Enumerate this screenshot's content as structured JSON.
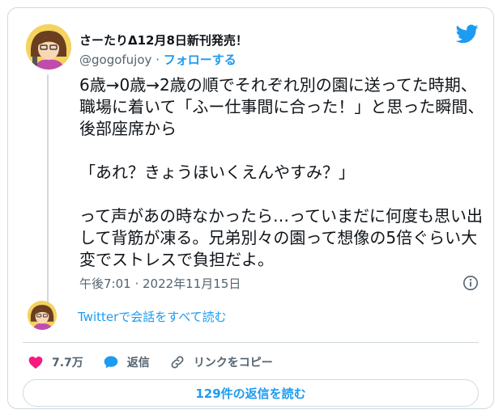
{
  "user": {
    "display_name": "さーたりΔ12月8日新刊発売！",
    "handle": "@gogofujoy",
    "separator": " · ",
    "follow_label": "フォローする"
  },
  "tweet": {
    "paragraphs": [
      "6歳→0歳→2歳の順でそれぞれ別の園に送ってた時期、職場に着いて「ふー仕事間に合った！」と思った瞬間、後部座席から",
      "「あれ？きょうほいくえんやすみ？」",
      "って声があの時なかったら…っていまだに何度も思い出して背筋が凍る。兄弟別々の園って想像の5倍ぐらい大変でストレスで負担だよ。"
    ],
    "timestamp": "午後7:01 · 2022年11月15日"
  },
  "conversation_link": "Twitterで会話をすべて読む",
  "actions": {
    "like_count": "7.7万",
    "reply_label": "返信",
    "copy_link_label": "リンクをコピー"
  },
  "read_replies_label": "129件の返信を読む",
  "colors": {
    "accent": "#1d9bf0",
    "like": "#f91880",
    "text": "#0f1419",
    "muted": "#536471",
    "border": "#cfd9de"
  },
  "icons": [
    "twitter-bird-icon",
    "info-icon",
    "heart-icon",
    "reply-bubble-icon",
    "link-icon"
  ]
}
